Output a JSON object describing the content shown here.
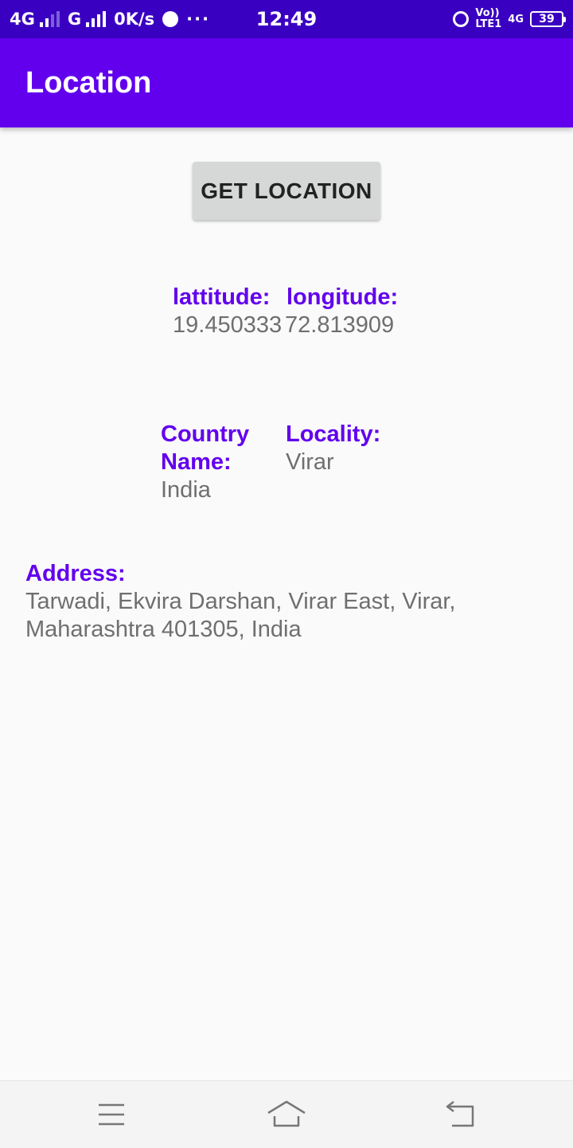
{
  "status_bar": {
    "network1": "4G",
    "network2": "G",
    "speed": "0K/s",
    "more": "···",
    "time": "12:49",
    "volte": "Vo))",
    "lte": "LTE1",
    "net4g": "4G",
    "battery": "39"
  },
  "app_bar": {
    "title": "Location"
  },
  "button": {
    "label": "GET LOCATION"
  },
  "coords": {
    "latitude_label": "lattitude:",
    "latitude_value": "19.450333",
    "longitude_label": "longitude:",
    "longitude_value": "72.813909"
  },
  "place": {
    "country_label_line1": "Country",
    "country_label_line2": "Name:",
    "country_value": "India",
    "locality_label": "Locality:",
    "locality_value": "Virar"
  },
  "address": {
    "label": "Address:",
    "line1": "Tarwadi, Ekvira Darshan, Virar East, Virar,",
    "line2": "Maharashtra 401305, India"
  },
  "nav_bar": {
    "icons": [
      "menu-icon",
      "home-icon",
      "back-icon"
    ]
  },
  "colors": {
    "status_bar": "#3a00c2",
    "app_bar": "#6200ee",
    "label": "#6200ee",
    "value": "#6f6f6f",
    "button": "#d6d7d7"
  }
}
